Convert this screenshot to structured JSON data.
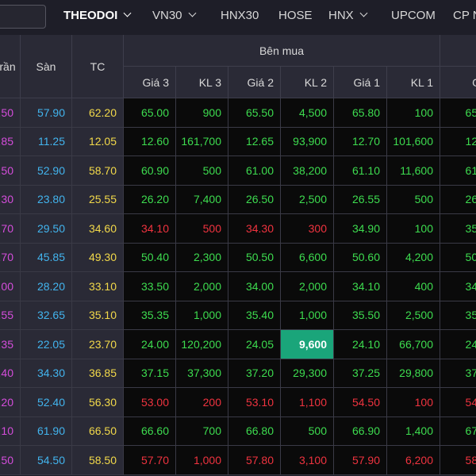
{
  "tabs": [
    {
      "label": "THEODOI",
      "active": true,
      "dropdown": true
    },
    {
      "label": "VN30",
      "active": false,
      "dropdown": true
    },
    {
      "label": "HNX30",
      "active": false,
      "dropdown": false
    },
    {
      "label": "HOSE",
      "active": false,
      "dropdown": false
    },
    {
      "label": "HNX",
      "active": false,
      "dropdown": true
    },
    {
      "label": "UPCOM",
      "active": false,
      "dropdown": false
    },
    {
      "label": "CP N",
      "active": false,
      "dropdown": false
    }
  ],
  "headers": {
    "ceiling": "rần",
    "floor": "Sàn",
    "ref": "TC",
    "buy_group": "Bên mua",
    "buy_cols": [
      "Giá 3",
      "KL 3",
      "Giá 2",
      "KL 2",
      "Giá 1",
      "KL 1",
      "G"
    ]
  },
  "rows": [
    {
      "ceil": ".50",
      "floor": "57.90",
      "ref": "62.20",
      "cells": [
        [
          "65.00",
          "up"
        ],
        [
          "900",
          "up"
        ],
        [
          "65.50",
          "up"
        ],
        [
          "4,500",
          "up"
        ],
        [
          "65.80",
          "up"
        ],
        [
          "100",
          "up"
        ],
        [
          "65.",
          "up"
        ]
      ]
    },
    {
      "ceil": ".85",
      "floor": "11.25",
      "ref": "12.05",
      "cells": [
        [
          "12.60",
          "up"
        ],
        [
          "161,700",
          "up"
        ],
        [
          "12.65",
          "up"
        ],
        [
          "93,900",
          "up"
        ],
        [
          "12.70",
          "up"
        ],
        [
          "101,600",
          "up"
        ],
        [
          "12.",
          "up"
        ]
      ]
    },
    {
      "ceil": ".50",
      "floor": "52.90",
      "ref": "58.70",
      "cells": [
        [
          "60.90",
          "up"
        ],
        [
          "500",
          "up"
        ],
        [
          "61.00",
          "up"
        ],
        [
          "38,200",
          "up"
        ],
        [
          "61.10",
          "up"
        ],
        [
          "11,600",
          "up"
        ],
        [
          "61.",
          "up"
        ]
      ]
    },
    {
      "ceil": ".30",
      "floor": "23.80",
      "ref": "25.55",
      "cells": [
        [
          "26.20",
          "up"
        ],
        [
          "7,400",
          "up"
        ],
        [
          "26.50",
          "up"
        ],
        [
          "2,500",
          "up"
        ],
        [
          "26.55",
          "up"
        ],
        [
          "500",
          "up"
        ],
        [
          "26.",
          "up"
        ]
      ]
    },
    {
      "ceil": ".70",
      "floor": "29.50",
      "ref": "34.60",
      "cells": [
        [
          "34.10",
          "down"
        ],
        [
          "500",
          "down"
        ],
        [
          "34.30",
          "down"
        ],
        [
          "300",
          "down"
        ],
        [
          "34.90",
          "up"
        ],
        [
          "100",
          "up"
        ],
        [
          "35.",
          "up"
        ]
      ]
    },
    {
      "ceil": ".70",
      "floor": "45.85",
      "ref": "49.30",
      "cells": [
        [
          "50.40",
          "up"
        ],
        [
          "2,300",
          "up"
        ],
        [
          "50.50",
          "up"
        ],
        [
          "6,600",
          "up"
        ],
        [
          "50.60",
          "up"
        ],
        [
          "4,200",
          "up"
        ],
        [
          "50.",
          "up"
        ]
      ]
    },
    {
      "ceil": ".00",
      "floor": "28.20",
      "ref": "33.10",
      "cells": [
        [
          "33.50",
          "up"
        ],
        [
          "2,000",
          "up"
        ],
        [
          "34.00",
          "up"
        ],
        [
          "2,000",
          "up"
        ],
        [
          "34.10",
          "up"
        ],
        [
          "400",
          "up"
        ],
        [
          "34.",
          "up"
        ]
      ]
    },
    {
      "ceil": ".55",
      "floor": "32.65",
      "ref": "35.10",
      "cells": [
        [
          "35.35",
          "up"
        ],
        [
          "1,000",
          "up"
        ],
        [
          "35.40",
          "up"
        ],
        [
          "1,000",
          "up"
        ],
        [
          "35.50",
          "up"
        ],
        [
          "2,500",
          "up"
        ],
        [
          "35.",
          "up"
        ]
      ]
    },
    {
      "ceil": ".35",
      "floor": "22.05",
      "ref": "23.70",
      "cells": [
        [
          "24.00",
          "up"
        ],
        [
          "120,200",
          "up"
        ],
        [
          "24.05",
          "up"
        ],
        [
          "9,600",
          "hl"
        ],
        [
          "24.10",
          "up"
        ],
        [
          "66,700",
          "up"
        ],
        [
          "24.",
          "up"
        ]
      ]
    },
    {
      "ceil": ".40",
      "floor": "34.30",
      "ref": "36.85",
      "cells": [
        [
          "37.15",
          "up"
        ],
        [
          "37,300",
          "up"
        ],
        [
          "37.20",
          "up"
        ],
        [
          "29,300",
          "up"
        ],
        [
          "37.25",
          "up"
        ],
        [
          "29,800",
          "up"
        ],
        [
          "37.",
          "up"
        ]
      ]
    },
    {
      "ceil": ".20",
      "floor": "52.40",
      "ref": "56.30",
      "cells": [
        [
          "53.00",
          "down"
        ],
        [
          "200",
          "down"
        ],
        [
          "53.10",
          "down"
        ],
        [
          "1,100",
          "down"
        ],
        [
          "54.50",
          "down"
        ],
        [
          "100",
          "down"
        ],
        [
          "54.",
          "down"
        ]
      ]
    },
    {
      "ceil": ".10",
      "floor": "61.90",
      "ref": "66.50",
      "cells": [
        [
          "66.60",
          "up"
        ],
        [
          "700",
          "up"
        ],
        [
          "66.80",
          "up"
        ],
        [
          "500",
          "up"
        ],
        [
          "66.90",
          "up"
        ],
        [
          "1,400",
          "up"
        ],
        [
          "67.",
          "up"
        ]
      ]
    },
    {
      "ceil": ".50",
      "floor": "54.50",
      "ref": "58.50",
      "cells": [
        [
          "57.70",
          "down"
        ],
        [
          "1,000",
          "down"
        ],
        [
          "57.80",
          "down"
        ],
        [
          "3,100",
          "down"
        ],
        [
          "57.90",
          "down"
        ],
        [
          "6,200",
          "down"
        ],
        [
          "58.",
          "down"
        ]
      ]
    }
  ]
}
